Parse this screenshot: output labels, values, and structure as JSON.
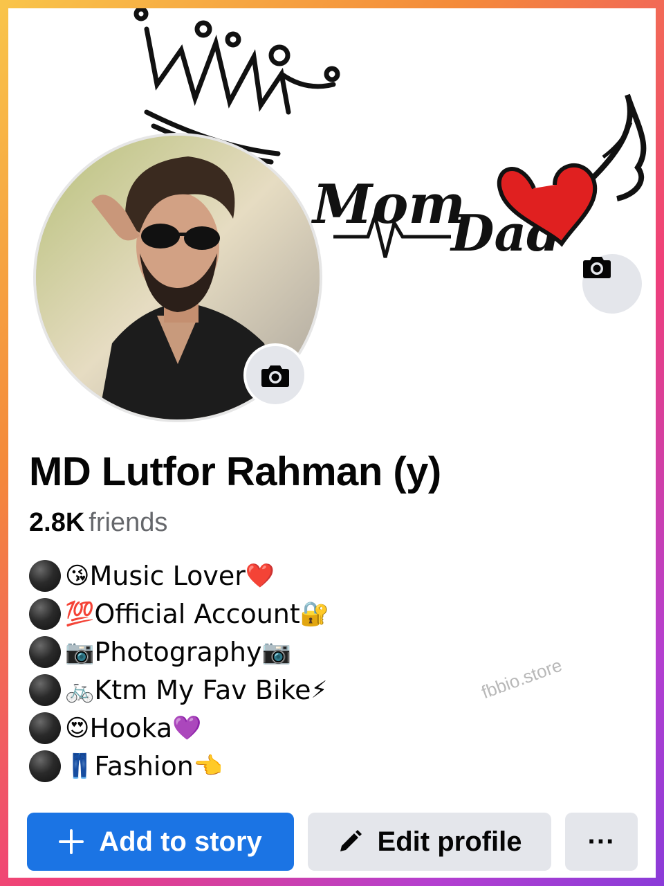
{
  "profile": {
    "name": "MD Lutfor Rahman (y)",
    "friends_count": "2.8K",
    "friends_label": "friends"
  },
  "cover": {
    "text_mom": "Mom",
    "text_dad": "Dad",
    "camera_icon": "camera-icon"
  },
  "avatar": {
    "camera_icon": "camera-icon"
  },
  "bio": [
    {
      "bullet": "black-circle",
      "emoji": "😘",
      "text": "Music Lover ",
      "trail": "❤️"
    },
    {
      "bullet": "black-circle",
      "emoji": "💯",
      "text": "Official Account",
      "trail": "🔐"
    },
    {
      "bullet": "black-circle",
      "emoji": "📷",
      "text": "Photography",
      "trail": "📷"
    },
    {
      "bullet": "black-circle",
      "emoji": "🚲",
      "text": "Ktm My Fav Bike",
      "trail": "⚡"
    },
    {
      "bullet": "black-circle",
      "emoji": "😍",
      "text": "Hooka ",
      "trail": "💜"
    },
    {
      "bullet": "black-circle",
      "emoji": "👖",
      "text": " Fashion",
      "trail": "👈"
    }
  ],
  "watermark": "fbbio.store",
  "actions": {
    "add_story": "Add to story",
    "edit_profile": "Edit profile",
    "more": "···"
  },
  "colors": {
    "primary": "#1b74e4",
    "secondary_button": "#e4e6eb",
    "heart": "#e02020",
    "frame_gradient": [
      "#f9c54a",
      "#ef3f7a",
      "#8a3bd8"
    ]
  }
}
